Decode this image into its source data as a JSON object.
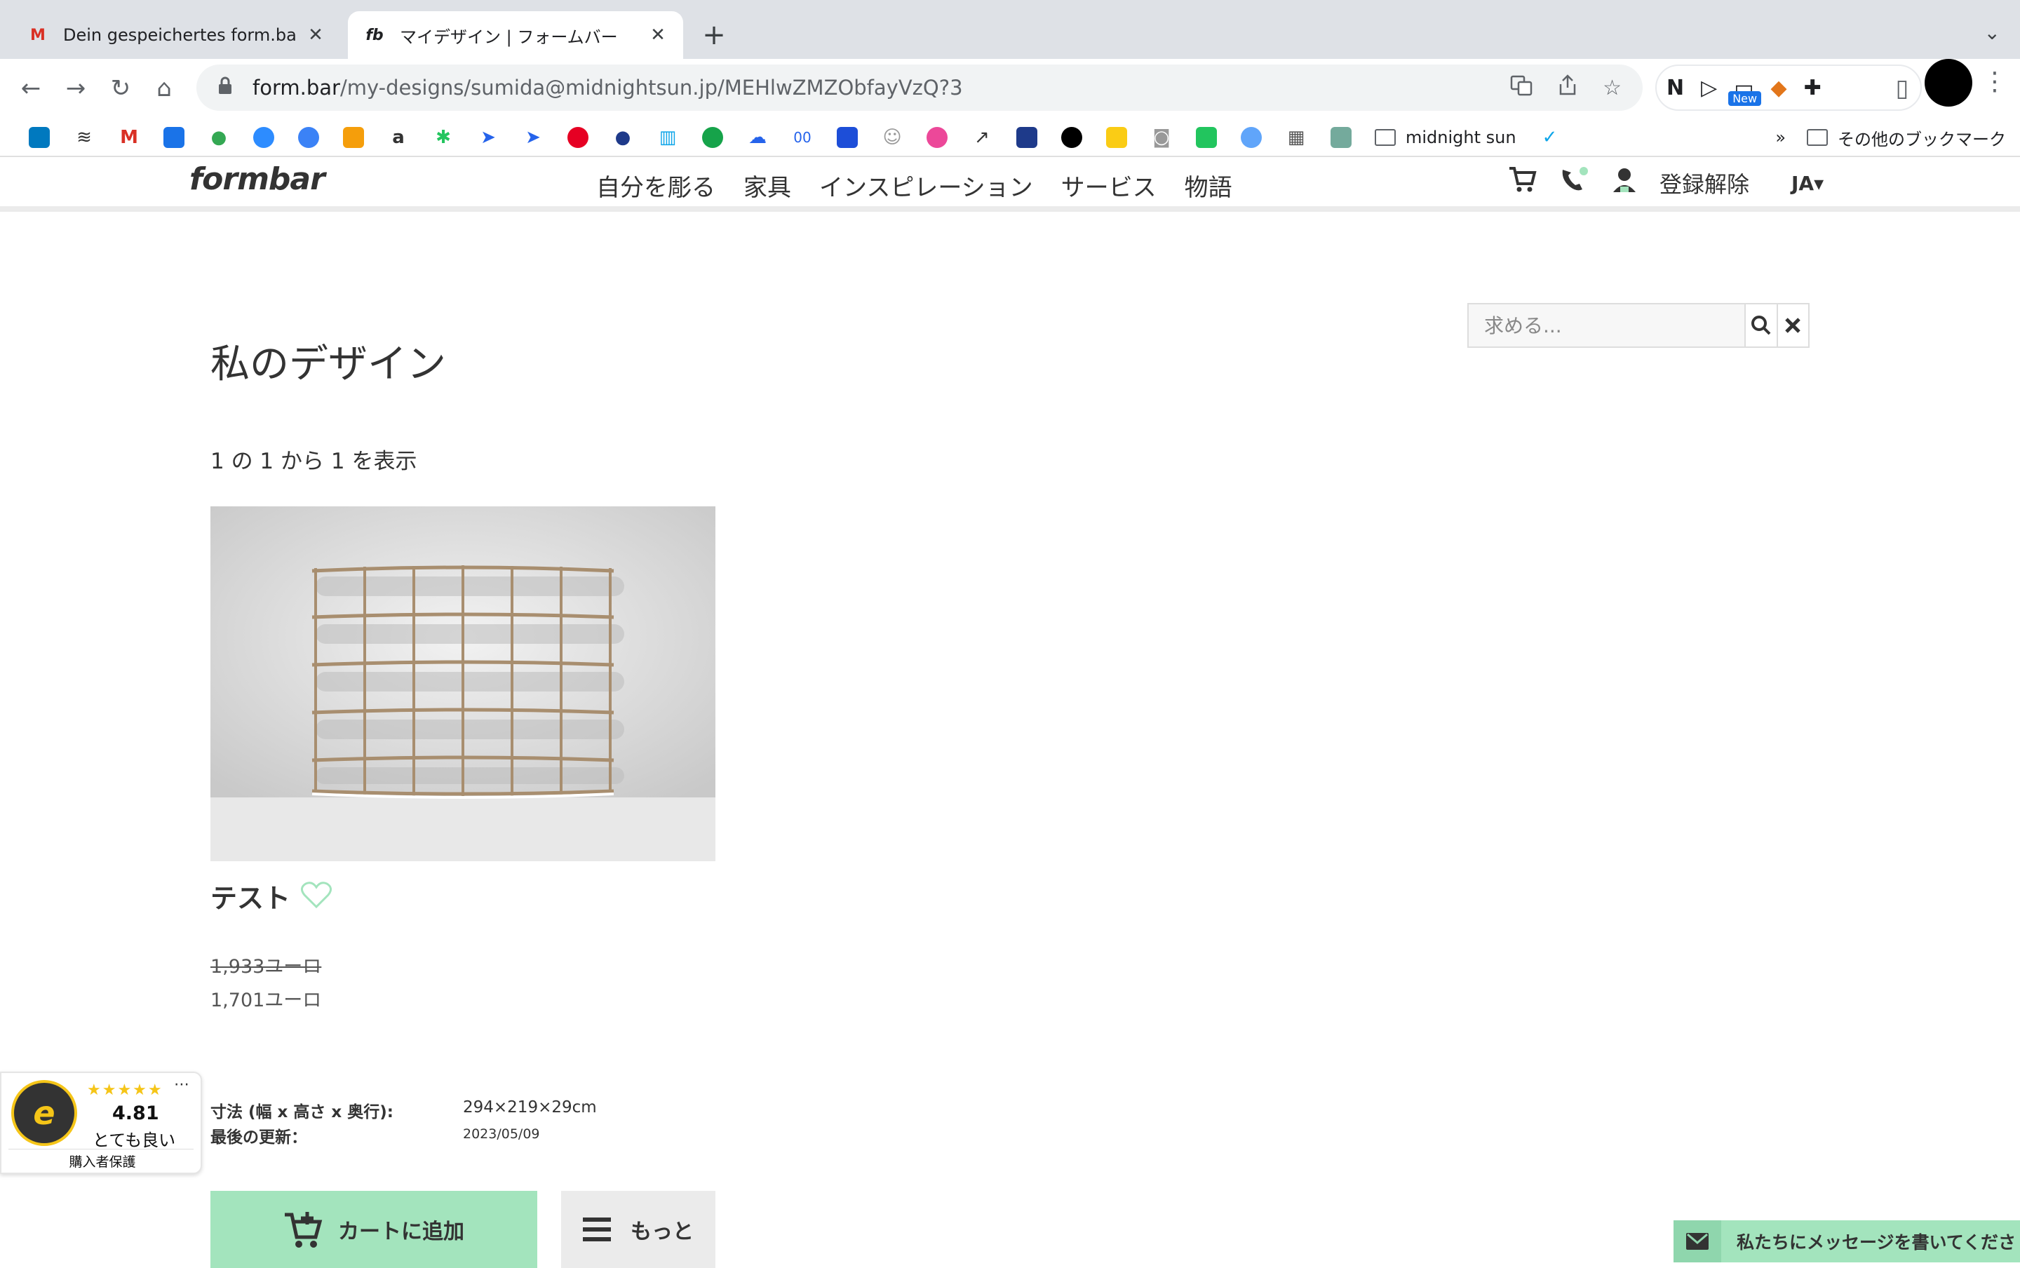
{
  "browser": {
    "tabs": [
      {
        "title": "Dein gespeichertes form.bar-D",
        "active": false
      },
      {
        "title": "マイデザイン | フォームバー",
        "active": true
      }
    ],
    "url_host": "form.bar",
    "url_path": "/my-designs/sumida@midnightsun.jp/MEHlwZMZObfayVzQ?3",
    "extension_badge": "New",
    "bookmark_folder": "midnight sun",
    "bookmarks_overflow": "»",
    "other_bookmarks": "その他のブックマーク"
  },
  "site": {
    "logo": "formbar",
    "nav": [
      "自分を彫る",
      "家具",
      "インスピレーション",
      "サービス",
      "物語"
    ],
    "account_label": "登録解除",
    "language": "JA"
  },
  "page": {
    "title": "私のデザイン",
    "search_placeholder": "求める...",
    "results_count": "1 の 1 から 1 を表示"
  },
  "product": {
    "name": "テスト",
    "price_old": "1,933ユーロ",
    "price_new": "1,701ユーロ",
    "dimensions_label": "寸法 (幅 x 高さ x 奥行):",
    "dimensions_value": "294×219×29cm",
    "updated_label": "最後の更新：",
    "updated_value": "2023/05/09",
    "add_to_cart": "カートに追加",
    "more": "もっと"
  },
  "trust_widget": {
    "stars": "★★★★★",
    "score": "4.81",
    "rating_text": "とても良い",
    "buyer_protection": "購入者保護",
    "seal_letter": "e"
  },
  "chat": {
    "message": "私たちにメッセージを書いてくださ"
  },
  "colors": {
    "accent_green": "#a3e4bd",
    "text_dark": "#333333",
    "chrome_tabbar": "#dee1e6"
  }
}
